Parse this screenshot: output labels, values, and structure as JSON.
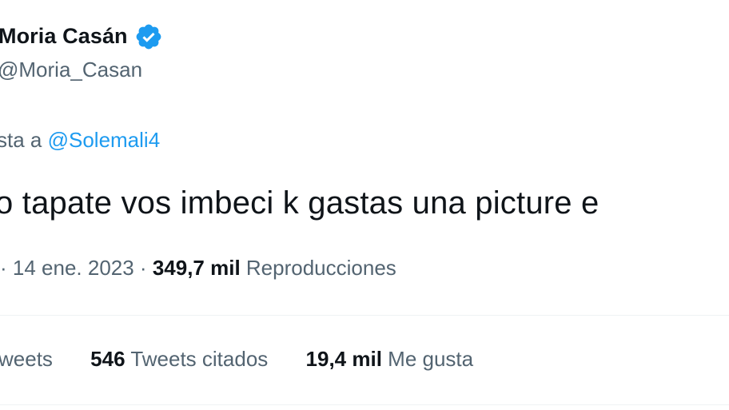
{
  "author": {
    "display_name": "Moria Casán",
    "handle": "@Moria_Casan",
    "verified_color": "#1d9bf0"
  },
  "reply": {
    "prefix": "sta a ",
    "mention": "@Solemali4"
  },
  "tweet": {
    "text": "o tapate vos imbeci  k gastas una picture e"
  },
  "meta": {
    "time_fragment": "· 14 ene. 2023 ·",
    "views_count": "349,7 mil",
    "views_label": "Reproducciones"
  },
  "stats": {
    "retweets_label": "weets",
    "quotes_count": "546",
    "quotes_label": "Tweets citados",
    "likes_count": "19,4 mil",
    "likes_label": "Me gusta"
  },
  "colors": {
    "text_primary": "#0f1419",
    "text_secondary": "#536471",
    "link": "#1d9bf0",
    "divider": "#eff3f4"
  }
}
